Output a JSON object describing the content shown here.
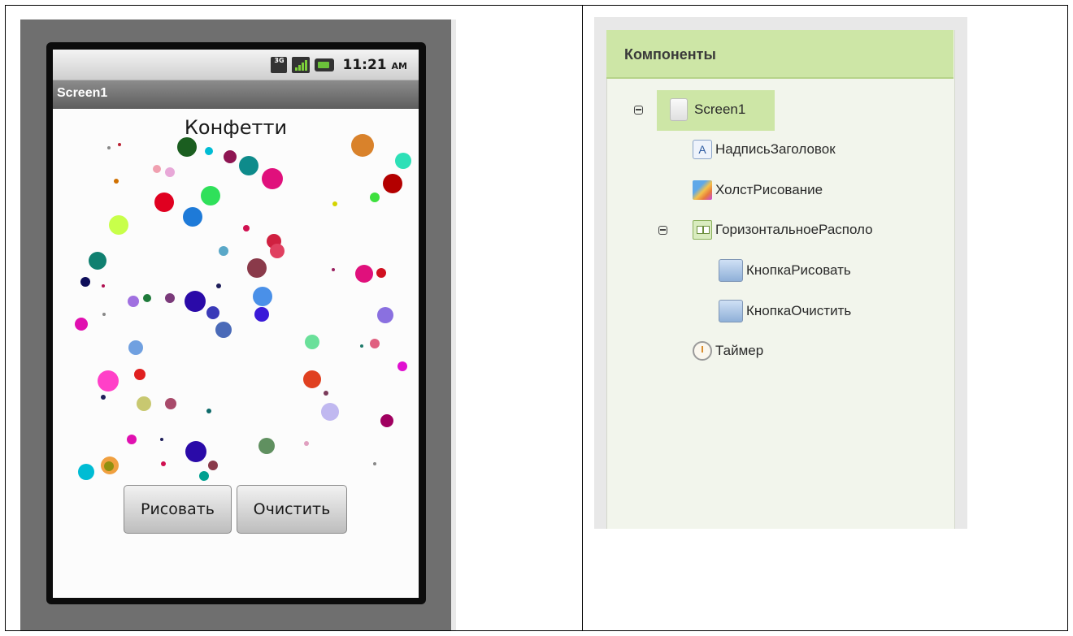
{
  "phone": {
    "status_time": "11:21",
    "status_ampm": "AM",
    "signal_badge": "3G",
    "screen_title": "Screen1",
    "app_title": "Конфетти",
    "button_draw": "Рисовать",
    "button_clear": "Очистить"
  },
  "components": {
    "header": "Компоненты",
    "items": [
      {
        "label": "Screen1",
        "icon": "screen-icon"
      },
      {
        "label": "НадписьЗаголовок",
        "icon": "label-icon",
        "icon_text": "A"
      },
      {
        "label": "ХолстРисование",
        "icon": "canvas-icon"
      },
      {
        "label": "ГоризонтальноеРасполо",
        "icon": "horizontal-arrangement-icon"
      },
      {
        "label": "КнопкаРисовать",
        "icon": "button-icon"
      },
      {
        "label": "КнопкаОчистить",
        "icon": "button-icon"
      },
      {
        "label": "Таймер",
        "icon": "timer-icon"
      }
    ]
  }
}
